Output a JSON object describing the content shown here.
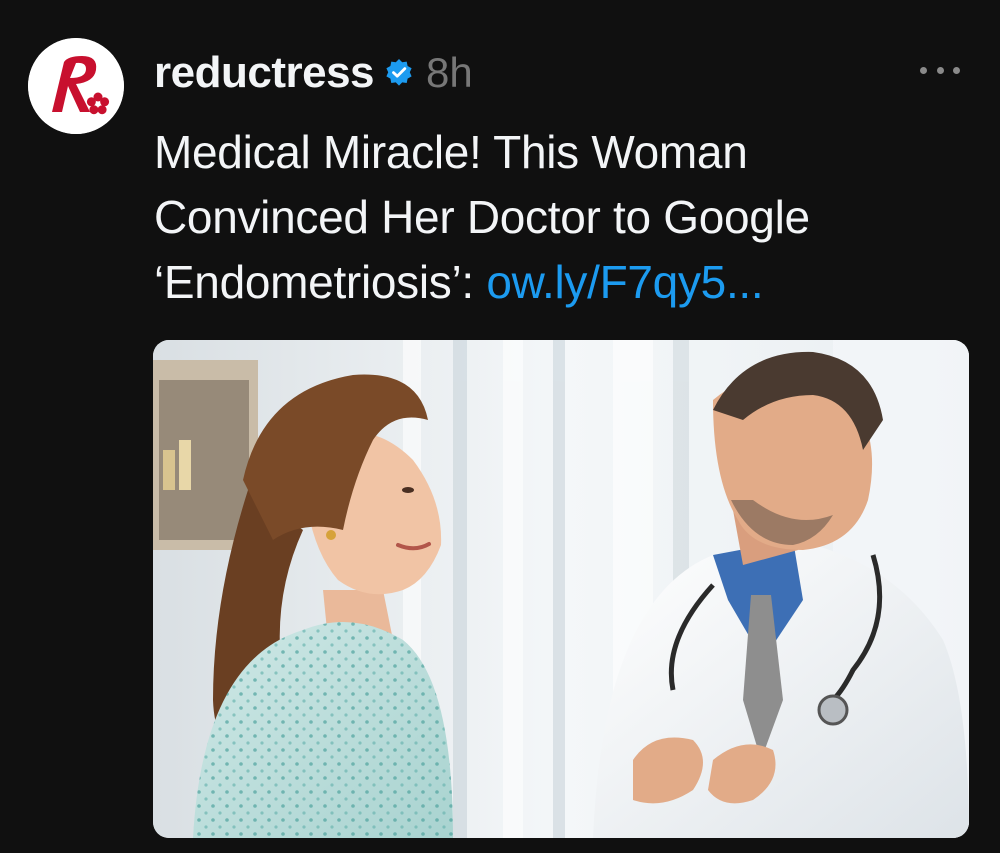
{
  "post": {
    "author": {
      "username": "reductress",
      "verified": true,
      "avatar_icon": "reductress-logo-icon"
    },
    "timestamp": "8h",
    "caption_text": "Medical Miracle! This Woman Convinced Her Doctor to Google ‘Endometriosis’:",
    "link_text": "ow.ly/F7qy5...",
    "more_icon": "more-options-icon",
    "media": {
      "description_icon": "post-photo"
    }
  },
  "colors": {
    "background": "#101010",
    "text": "#f3f5f7",
    "muted": "#777777",
    "link": "#1c9bf0",
    "verified_badge": "#1c9bf0",
    "brand": "#c8102e"
  }
}
